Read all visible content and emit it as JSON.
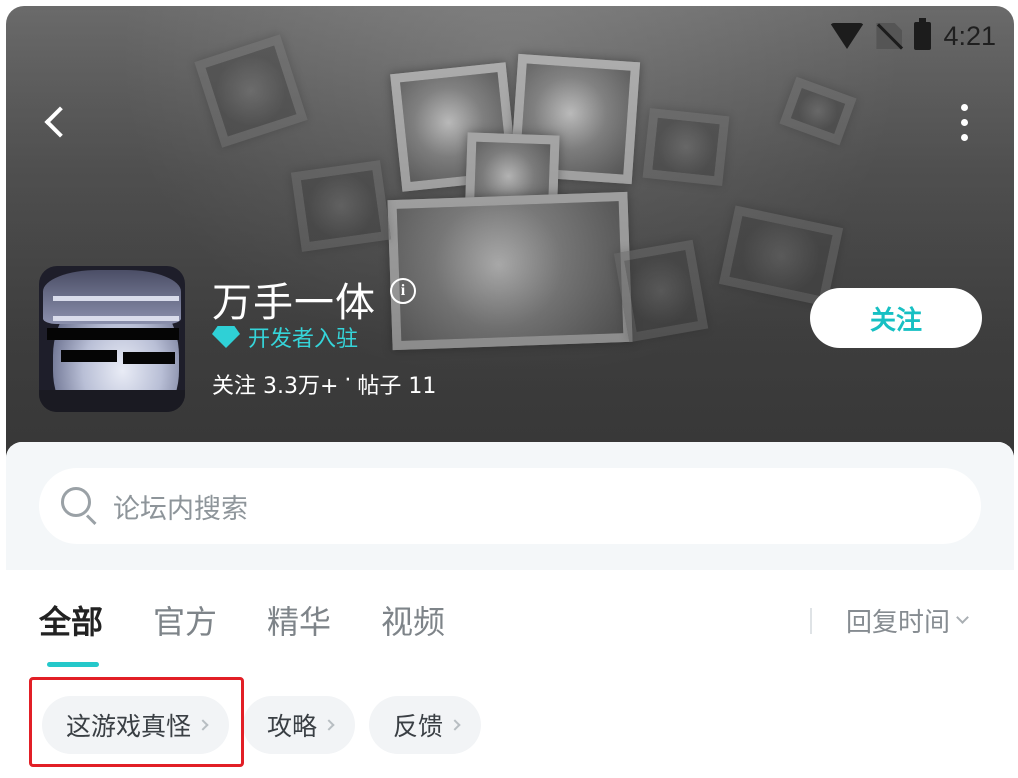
{
  "status_bar": {
    "time": "4:21",
    "icons": [
      "wifi-icon",
      "sim-no-signal-icon",
      "battery-icon"
    ]
  },
  "nav": {
    "back_icon": "chevron-left-icon",
    "more_icon": "more-vertical-icon"
  },
  "profile": {
    "name": "万手一体",
    "info_icon": "info-icon",
    "info_glyph": "i",
    "badge": {
      "icon": "diamond-icon",
      "label": "开发者入驻",
      "color": "#35d4d9"
    },
    "stats": {
      "followers_label": "关注 3.3万+",
      "separator": "·",
      "posts_label": "帖子 11"
    },
    "follow_button": "关注"
  },
  "search": {
    "placeholder": "论坛内搜索",
    "icon": "search-icon"
  },
  "tabs": [
    {
      "label": "全部",
      "active": true
    },
    {
      "label": "官方",
      "active": false
    },
    {
      "label": "精华",
      "active": false
    },
    {
      "label": "视频",
      "active": false
    }
  ],
  "sort": {
    "label": "回复时间",
    "icon": "chevron-down-icon"
  },
  "chips": [
    {
      "label": "这游戏真怪",
      "highlighted": true
    },
    {
      "label": "攻略",
      "highlighted": false
    },
    {
      "label": "反馈",
      "highlighted": false
    }
  ],
  "colors": {
    "accent": "#24c8ca",
    "highlight": "#e21f26"
  }
}
